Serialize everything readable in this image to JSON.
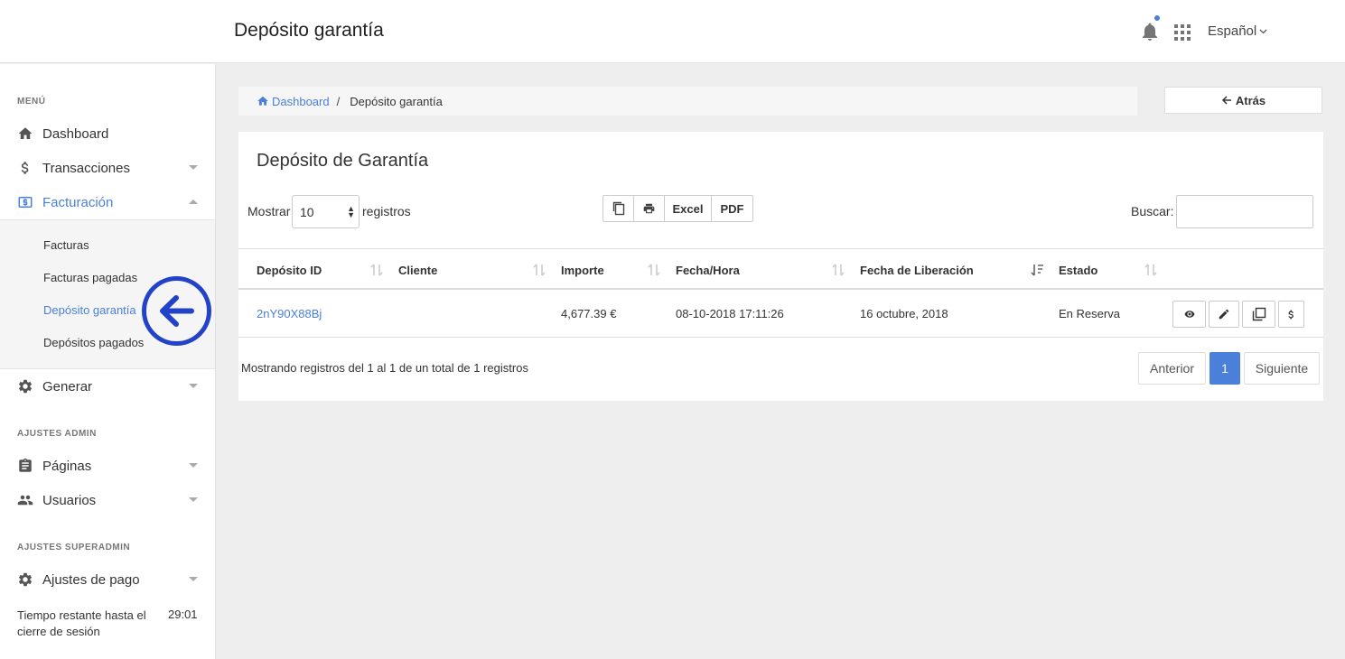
{
  "header": {
    "title": "Depósito garantía",
    "language": "Español"
  },
  "sidebar": {
    "menu_label": "MENÚ",
    "items": [
      {
        "label": "Dashboard",
        "icon": "home-icon"
      },
      {
        "label": "Transacciones",
        "icon": "dollar-icon"
      },
      {
        "label": "Facturación",
        "icon": "invoice-icon"
      }
    ],
    "submenu": [
      "Facturas",
      "Facturas pagadas",
      "Depósito garantía",
      "Depósitos pagados"
    ],
    "generar": "Generar",
    "admin_label": "AJUSTES ADMIN",
    "admin_items": [
      "Páginas",
      "Usuarios"
    ],
    "superadmin_label": "AJUSTES SUPERADMIN",
    "superadmin_items": [
      "Ajustes de pago"
    ],
    "session_text": "Tiempo restante hasta el cierre de sesión",
    "session_time": "29:01"
  },
  "breadcrumb": {
    "home": "Dashboard",
    "separator": "/",
    "current": "Depósito garantía"
  },
  "back_button": "Atrás",
  "card": {
    "title": "Depósito de Garantía",
    "show_label": "Mostrar",
    "show_value": "10",
    "records_label": "registros",
    "buttons": {
      "excel": "Excel",
      "pdf": "PDF"
    },
    "search_label": "Buscar:",
    "columns": [
      "Depósito ID",
      "Cliente",
      "Importe",
      "Fecha/Hora",
      "Fecha de Liberación",
      "Estado"
    ],
    "rows": [
      {
        "id": "2nY90X88Bj",
        "cliente": "",
        "importe": "4,677.39 €",
        "fecha_hora": "08-10-2018 17:11:26",
        "liberacion": "16 octubre, 2018",
        "estado": "En Reserva"
      }
    ],
    "info": "Mostrando registros del 1 al 1 de un total de 1 registros",
    "pagination": {
      "prev": "Anterior",
      "current": "1",
      "next": "Siguiente"
    }
  },
  "colors": {
    "accent": "#4a80d9",
    "annotation": "#2242c8"
  }
}
